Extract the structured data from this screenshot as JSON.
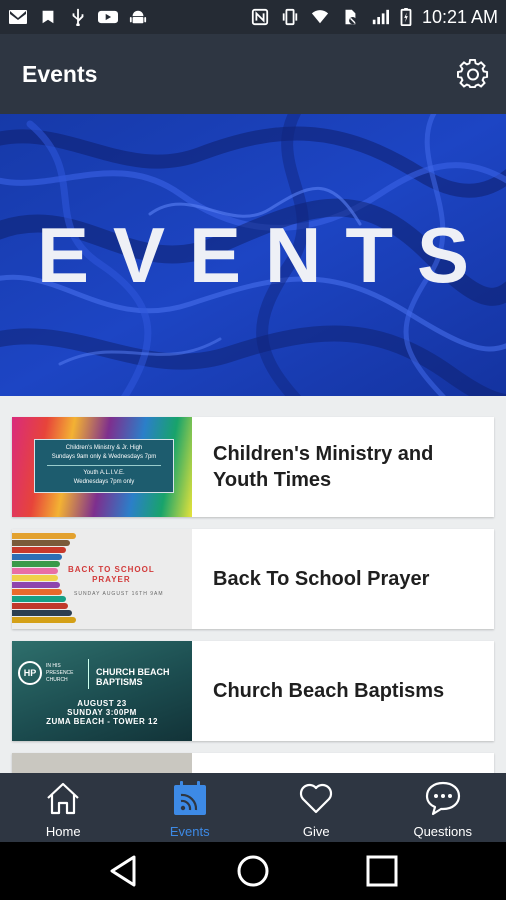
{
  "status_bar": {
    "time": "10:21 AM",
    "left_icons": [
      "gmail-icon",
      "maps-icon",
      "usb-icon",
      "youtube-icon",
      "android-icon"
    ],
    "right_icons": [
      "nfc-icon",
      "vibrate-icon",
      "wifi-icon",
      "no-sim-icon",
      "signal-icon",
      "battery-icon"
    ]
  },
  "app_bar": {
    "title": "Events",
    "settings_icon": "gear-icon"
  },
  "banner": {
    "text": "EVENTS"
  },
  "events": [
    {
      "title": "Children's Ministry and Youth Times",
      "thumb": {
        "line1": "Children's Ministry & Jr. High",
        "line2": "Sundays 9am only & Wednesdays 7pm",
        "line3": "Youth A.L.I.V.E.",
        "line4": "Wednesdays 7pm only"
      }
    },
    {
      "title": "Back To School Prayer",
      "thumb": {
        "line1": "BACK TO SCHOOL",
        "line2": "PRAYER",
        "line3": "SUNDAY AUGUST 16TH 9AM"
      }
    },
    {
      "title": "Church Beach Baptisms",
      "thumb": {
        "logo": "HP",
        "church": "IN HIS PRESENCE CHURCH",
        "line1": "CHURCH BEACH",
        "line2": "BAPTISMS",
        "line3": "AUGUST 23",
        "line4": "SUNDAY 3:00PM",
        "line5": "ZUMA BEACH - TOWER 12"
      }
    }
  ],
  "bottom_nav": {
    "items": [
      {
        "label": "Home",
        "icon": "home-icon",
        "active": false
      },
      {
        "label": "Events",
        "icon": "calendar-icon",
        "active": true
      },
      {
        "label": "Give",
        "icon": "heart-icon",
        "active": false
      },
      {
        "label": "Questions",
        "icon": "chat-bubble-icon",
        "active": false
      }
    ]
  },
  "colors": {
    "app_bar_bg": "#2e3642",
    "status_bar_bg": "#252b34",
    "active_tab": "#3d8ae6",
    "banner_blue": "#1a3db5"
  }
}
